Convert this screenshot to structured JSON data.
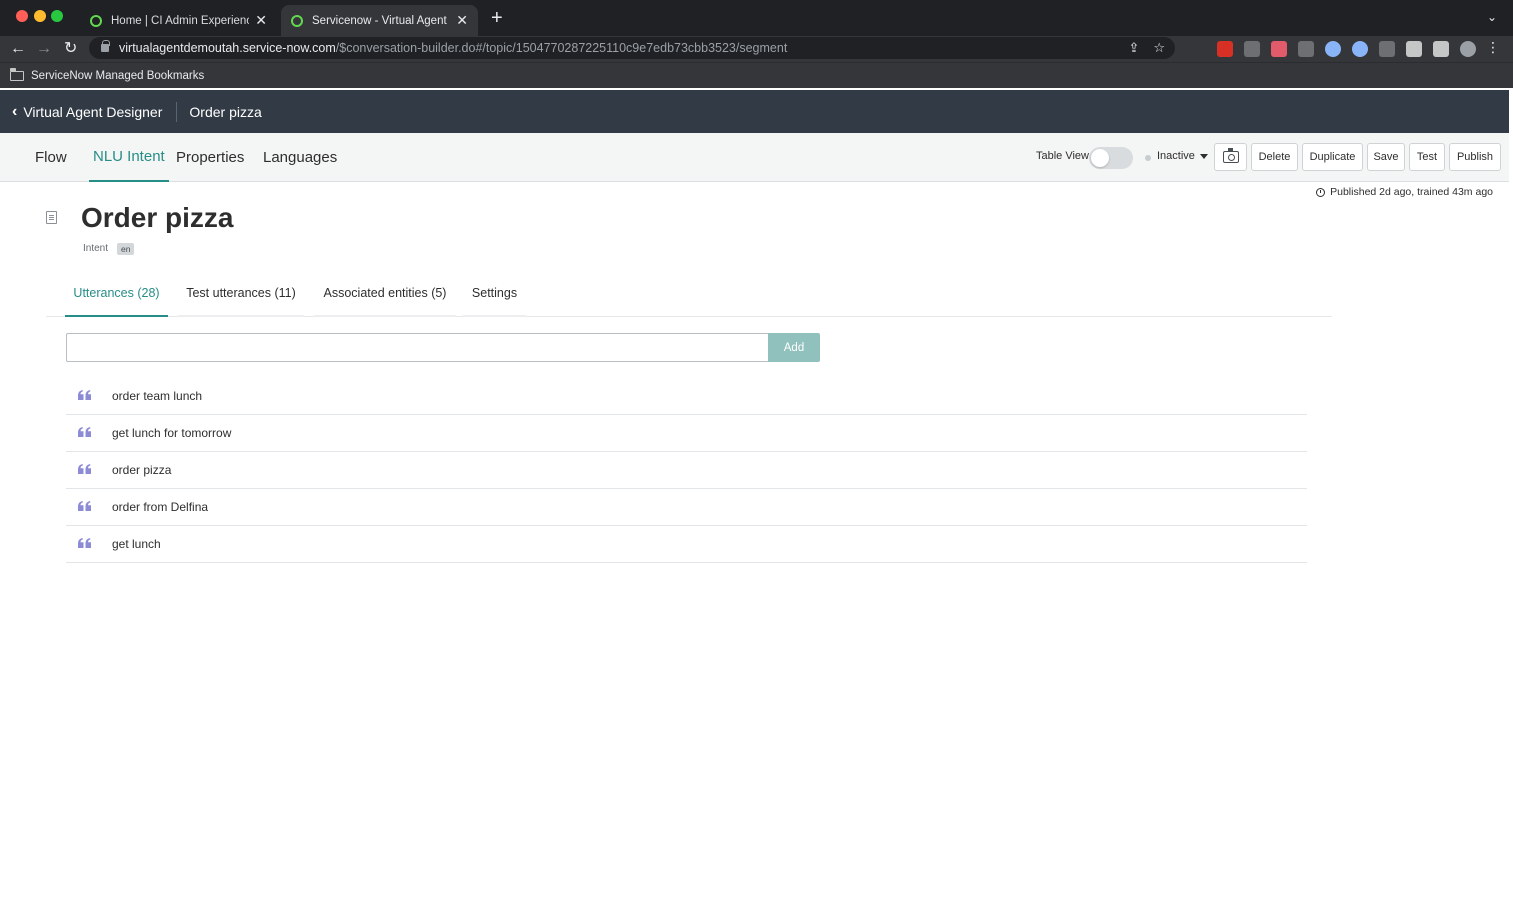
{
  "browser": {
    "tabs": [
      {
        "title": "Home | CI Admin Experience | S",
        "close": "✕"
      },
      {
        "title": "Servicenow - Virtual Agent Des",
        "close": "✕"
      }
    ],
    "new_tab": "+",
    "url_host": "virtualagentdemoutah.service-now.com",
    "url_path": "/$conversation-builder.do#/topic/1504770287225110c9e7edb73cbb3523/segment",
    "bookmark": "ServiceNow Managed Bookmarks"
  },
  "header": {
    "back_label": "Virtual Agent Designer",
    "title": "Order pizza"
  },
  "subnav": {
    "tabs": [
      "Flow",
      "NLU Intent",
      "Properties",
      "Languages"
    ],
    "active_tab": "NLU Intent",
    "table_view_label": "Table View",
    "status": "Inactive",
    "buttons": {
      "delete": "Delete",
      "duplicate": "Duplicate",
      "save": "Save",
      "test": "Test",
      "publish": "Publish"
    }
  },
  "published_info": "Published 2d ago, trained 43m ago",
  "intent": {
    "title": "Order pizza",
    "type_label": "Intent",
    "language": "en"
  },
  "inner_tabs": [
    {
      "label": "Utterances (28)"
    },
    {
      "label": "Test utterances (11)"
    },
    {
      "label": "Associated entities (5)"
    },
    {
      "label": "Settings"
    }
  ],
  "utterance_input": {
    "value": "",
    "add_label": "Add"
  },
  "utterances": [
    "order team lunch",
    "get lunch for tomorrow",
    "order pizza",
    "order from Delfina",
    "get lunch"
  ],
  "colors": {
    "accent": "#278d87",
    "header_bg": "#323b45",
    "add_button": "#91c1bd",
    "quote_icon": "#8d8bd6"
  }
}
